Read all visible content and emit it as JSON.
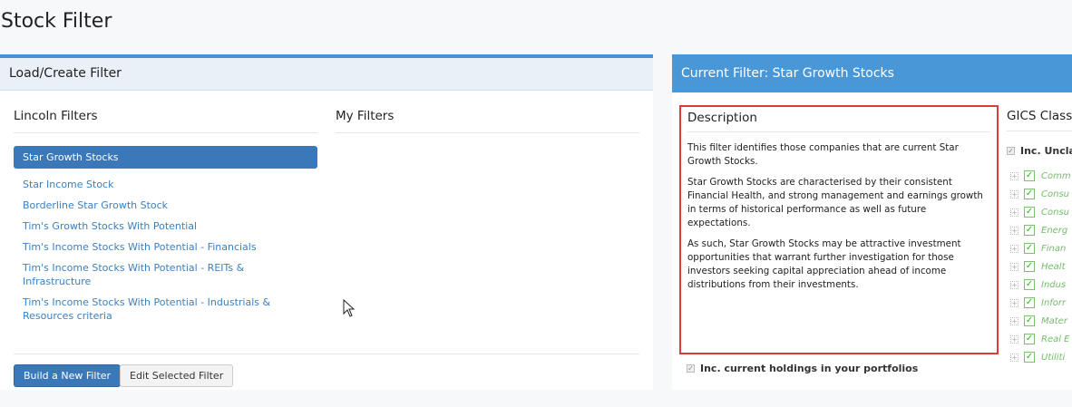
{
  "page": {
    "title": "Stock Filter"
  },
  "left_panel": {
    "header": "Load/Create Filter",
    "lincoln_title": "Lincoln Filters",
    "my_title": "My Filters",
    "filters": [
      "Star Growth Stocks",
      "Star Income Stock",
      "Borderline Star Growth Stock",
      "Tim's Growth Stocks With Potential",
      "Tim's Income Stocks With Potential - Financials",
      "Tim's Income Stocks With Potential - REITs & Infrastructure",
      "Tim's Income Stocks With Potential - Industrials & Resources criteria"
    ],
    "selected_index": 0,
    "build_button": "Build a New Filter",
    "edit_button": "Edit Selected Filter"
  },
  "right_panel": {
    "header": "Current Filter: Star Growth Stocks",
    "description_title": "Description",
    "description": [
      "This filter identifies those companies that are current Star Growth Stocks.",
      "Star Growth Stocks are characterised by their consistent Financial Health, and strong management and earnings growth in terms of historical performance as well as future expectations.",
      "As such, Star Growth Stocks may be attractive investment opportunities that warrant further investigation for those investors seeking capital appreciation ahead of income distributions from their investments."
    ],
    "holdings_label": "Inc. current holdings in your portfolios",
    "gics_title": "GICS Classi",
    "inc_unclass_label": "Inc. Unclas",
    "gics_items": [
      "Comm",
      "Consu",
      "Consu",
      "Energ",
      "Finan",
      "Healt",
      "Indus",
      "Inforr",
      "Mater",
      "Real E",
      "Utiliti"
    ]
  },
  "colors": {
    "accent": "#4a97d8",
    "selected": "#3a78b9",
    "highlight_border": "#e23a3a",
    "check_green": "#77b96e"
  }
}
